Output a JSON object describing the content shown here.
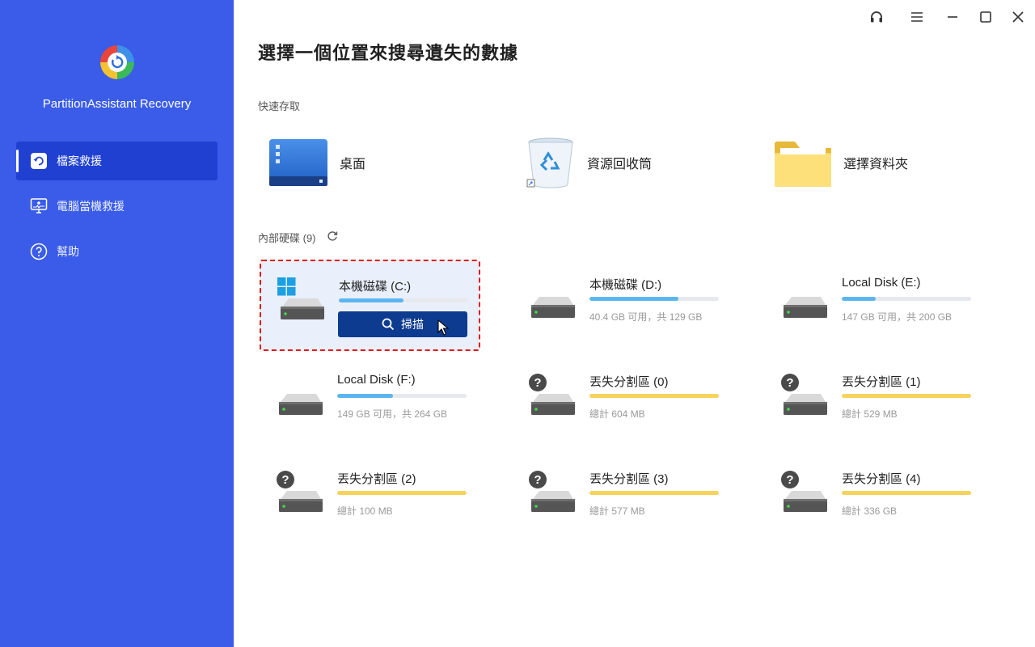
{
  "app": {
    "name": "PartitionAssistant Recovery"
  },
  "sidebar": {
    "items": [
      {
        "label": "檔案救援",
        "icon": "file-restore-icon",
        "active": true
      },
      {
        "label": "電腦當機救援",
        "icon": "monitor-rescue-icon",
        "active": false
      },
      {
        "label": "幫助",
        "icon": "help-icon",
        "active": false
      }
    ]
  },
  "titlebar": {
    "buttons": [
      "headset-icon",
      "menu-icon",
      "minimize-icon",
      "maximize-icon",
      "close-icon"
    ]
  },
  "main": {
    "title": "選擇一個位置來搜尋遺失的數據",
    "quick_access": {
      "label": "快速存取",
      "items": [
        {
          "label": "桌面",
          "icon": "desktop-icon"
        },
        {
          "label": "資源回收筒",
          "icon": "recycle-bin-icon"
        },
        {
          "label": "選擇資料夾",
          "icon": "folder-icon"
        }
      ]
    },
    "drives": {
      "label": "內部硬碟 (9)",
      "scan_label": "掃描",
      "items": [
        {
          "name": "本機磁碟 (C:)",
          "info": "",
          "used_fraction": 0.5,
          "color": "#5bb6ef",
          "type": "system",
          "selected": true
        },
        {
          "name": "本機磁碟 (D:)",
          "info": "40.4 GB 可用，共 129 GB",
          "used_fraction": 0.69,
          "color": "#5bb6ef",
          "type": "disk",
          "selected": false
        },
        {
          "name": "Local Disk (E:)",
          "info": "147 GB 可用，共 200 GB",
          "used_fraction": 0.26,
          "color": "#5bb6ef",
          "type": "disk",
          "selected": false
        },
        {
          "name": "Local Disk (F:)",
          "info": "149 GB 可用，共 264 GB",
          "used_fraction": 0.43,
          "color": "#5bb6ef",
          "type": "disk",
          "selected": false
        },
        {
          "name": "丟失分割區 (0)",
          "info": "總計 604 MB",
          "used_fraction": 1.0,
          "color": "#f7d35c",
          "type": "lost",
          "selected": false
        },
        {
          "name": "丟失分割區 (1)",
          "info": "總計 529 MB",
          "used_fraction": 1.0,
          "color": "#f7d35c",
          "type": "lost",
          "selected": false
        },
        {
          "name": "丟失分割區 (2)",
          "info": "總計 100 MB",
          "used_fraction": 1.0,
          "color": "#f7d35c",
          "type": "lost",
          "selected": false
        },
        {
          "name": "丟失分割區 (3)",
          "info": "總計 577 MB",
          "used_fraction": 1.0,
          "color": "#f7d35c",
          "type": "lost",
          "selected": false
        },
        {
          "name": "丟失分割區 (4)",
          "info": "總計 336 GB",
          "used_fraction": 1.0,
          "color": "#f7d35c",
          "type": "lost",
          "selected": false
        }
      ]
    }
  },
  "colors": {
    "sidebar": "#3a5ce8",
    "sidebar_active": "#2040d2",
    "scan_button": "#0d3b8f",
    "selection_border": "#e01b1b"
  }
}
